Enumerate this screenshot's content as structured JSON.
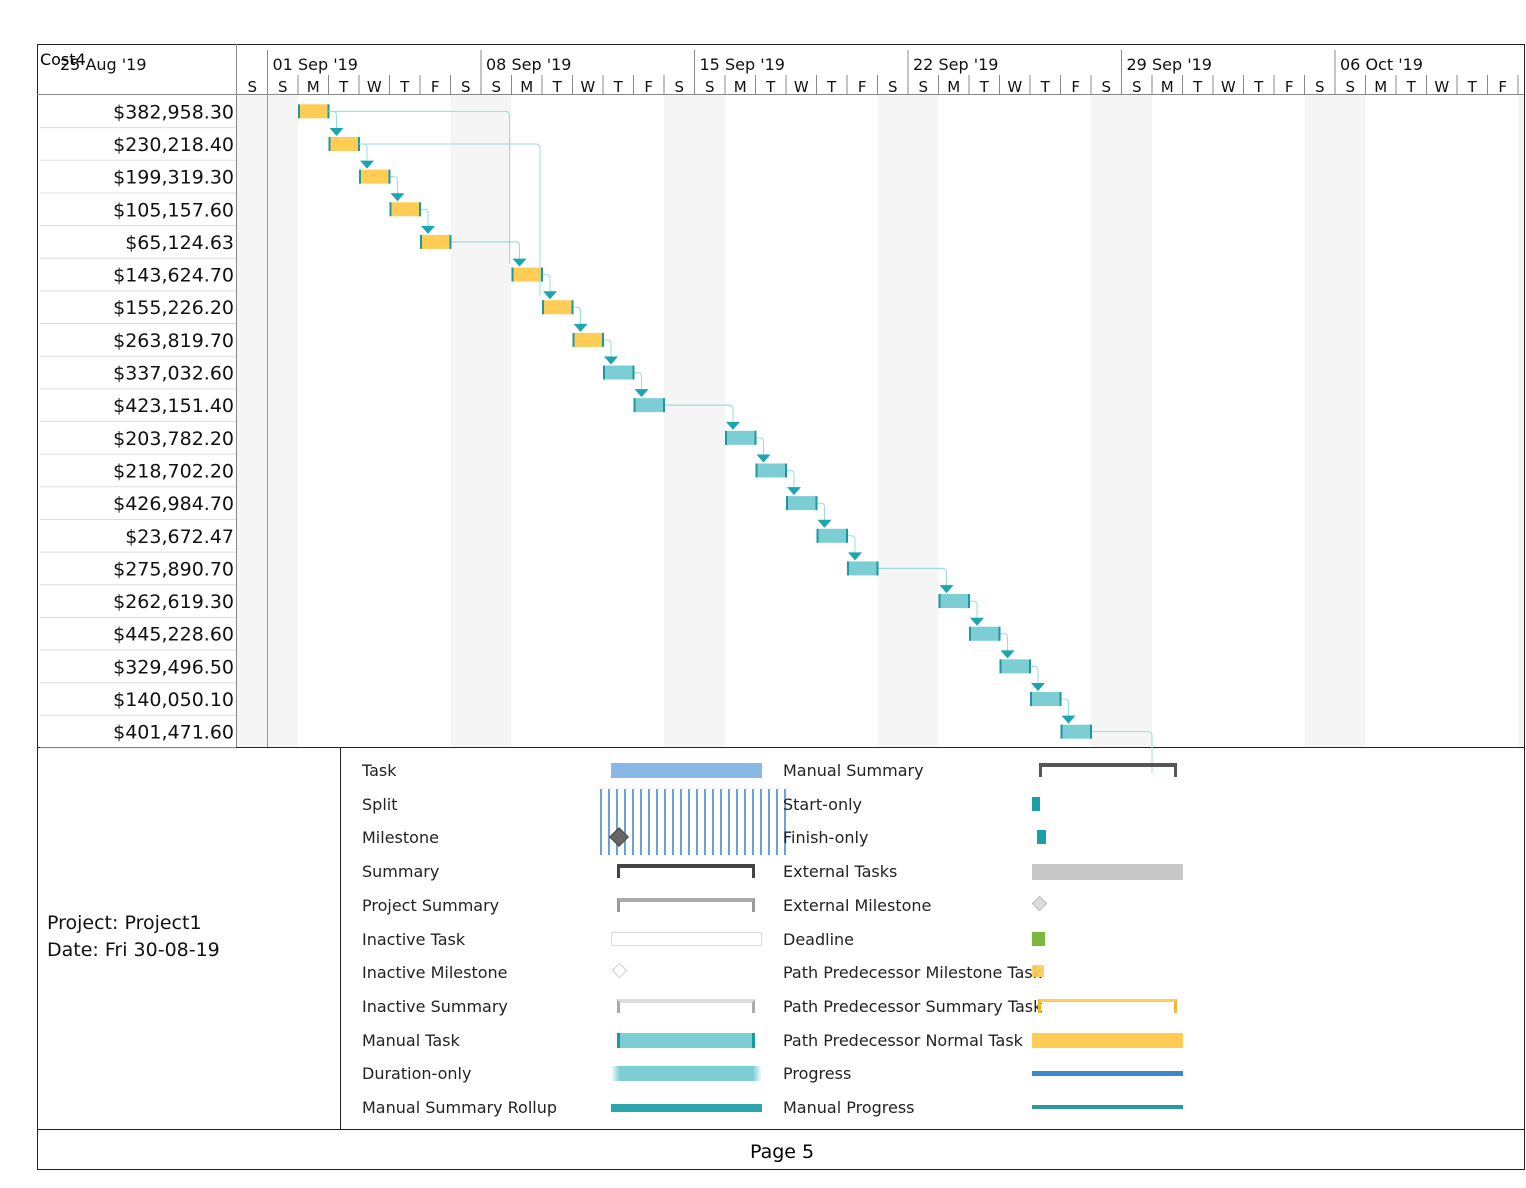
{
  "table": {
    "column_header": "Cost4"
  },
  "timescale": {
    "weeks": [
      "25 Aug '19",
      "01 Sep '19",
      "08 Sep '19",
      "15 Sep '19",
      "22 Sep '19",
      "29 Sep '19",
      "06 Oct '19"
    ],
    "day_letters": [
      "S",
      "M",
      "T",
      "W",
      "T",
      "F",
      "S"
    ]
  },
  "tasks": [
    {
      "cost": "$382,958.30",
      "start": "2019-09-02",
      "path": true
    },
    {
      "cost": "$230,218.40",
      "start": "2019-09-03",
      "path": true
    },
    {
      "cost": "$199,319.30",
      "start": "2019-09-04",
      "path": true
    },
    {
      "cost": "$105,157.60",
      "start": "2019-09-05",
      "path": true
    },
    {
      "cost": "$65,124.63",
      "start": "2019-09-06",
      "path": true
    },
    {
      "cost": "$143,624.70",
      "start": "2019-09-09",
      "path": true
    },
    {
      "cost": "$155,226.20",
      "start": "2019-09-10",
      "path": true
    },
    {
      "cost": "$263,819.70",
      "start": "2019-09-11",
      "path": true
    },
    {
      "cost": "$337,032.60",
      "start": "2019-09-12",
      "path": false
    },
    {
      "cost": "$423,151.40",
      "start": "2019-09-13",
      "path": false
    },
    {
      "cost": "$203,782.20",
      "start": "2019-09-16",
      "path": false
    },
    {
      "cost": "$218,702.20",
      "start": "2019-09-17",
      "path": false
    },
    {
      "cost": "$426,984.70",
      "start": "2019-09-18",
      "path": false
    },
    {
      "cost": "$23,672.47",
      "start": "2019-09-19",
      "path": false
    },
    {
      "cost": "$275,890.70",
      "start": "2019-09-20",
      "path": false
    },
    {
      "cost": "$262,619.30",
      "start": "2019-09-23",
      "path": false
    },
    {
      "cost": "$445,228.60",
      "start": "2019-09-24",
      "path": false
    },
    {
      "cost": "$329,496.50",
      "start": "2019-09-25",
      "path": false
    },
    {
      "cost": "$140,050.10",
      "start": "2019-09-26",
      "path": false
    },
    {
      "cost": "$401,471.60",
      "start": "2019-09-27",
      "path": false
    }
  ],
  "colors": {
    "path_task": "#ffcc55",
    "manual_task": "#7ccdd4",
    "manual_task_edge": "#1a9aa0",
    "link": "#9adcd8",
    "weekend": "#f5f5f5",
    "task": "#8ab8e6"
  },
  "info": {
    "project": "Project: Project1",
    "date": "Date: Fri 30-08-19"
  },
  "legend": {
    "left": [
      "Task",
      "Split",
      "Milestone",
      "Summary",
      "Project Summary",
      "Inactive Task",
      "Inactive Milestone",
      "Inactive Summary",
      "Manual Task",
      "Duration-only",
      "Manual Summary Rollup"
    ],
    "right": [
      "Manual Summary",
      "Start-only",
      "Finish-only",
      "External Tasks",
      "External Milestone",
      "Deadline",
      "Path Predecessor Milestone Task",
      "Path Predecessor Summary Task",
      "Path Predecessor Normal Task",
      "Progress",
      "Manual Progress"
    ]
  },
  "footer": {
    "page": "Page 5"
  }
}
